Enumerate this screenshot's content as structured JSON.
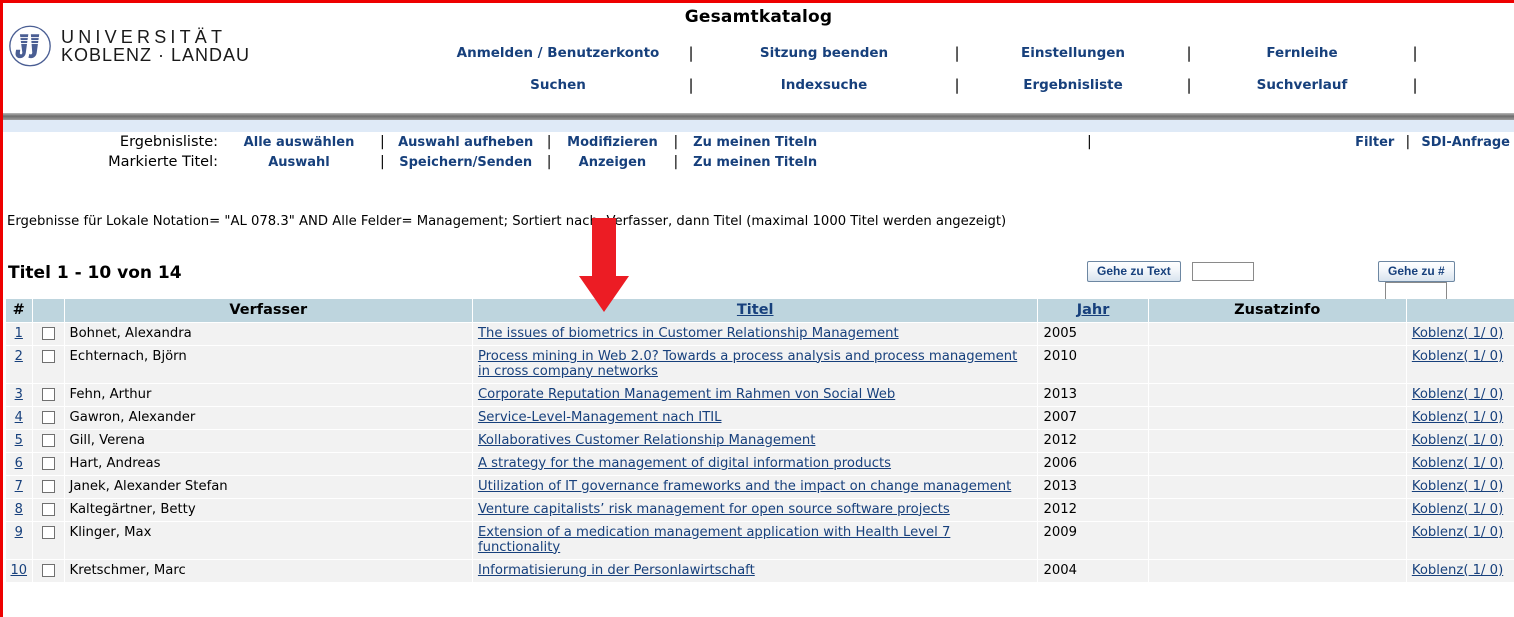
{
  "header": {
    "logo_line1": "UNIVERSITÄT",
    "logo_line2": "KOBLENZ · LANDAU",
    "catalog_title": "Gesamtkatalog",
    "nav_row1": [
      "Anmelden / Benutzerkonto",
      "Sitzung beenden",
      "Einstellungen",
      "Fernleihe"
    ],
    "nav_row2": [
      "Suchen",
      "Indexsuche",
      "Ergebnisliste",
      "Suchverlauf"
    ],
    "separator": "|"
  },
  "toolbar": {
    "row1_label": "Ergebnisliste:",
    "row1_links": [
      "Alle auswählen",
      "Auswahl aufheben",
      "Modifizieren",
      "Zu meinen Titeln"
    ],
    "row2_label": "Markierte Titel:",
    "row2_links": [
      "Auswahl",
      "Speichern/Senden",
      "Anzeigen",
      "Zu meinen Titeln"
    ],
    "right_links": [
      "Filter",
      "SDI-Anfrage"
    ],
    "separator": "|"
  },
  "query": {
    "description": "Ergebnisse für Lokale Notation= \"AL 078.3\" AND Alle Felder= Management; Sortiert nach: Verfasser, dann Titel (maximal 1000 Titel werden angezeigt)"
  },
  "results_info": {
    "count_text": "Titel 1 - 10 von 14",
    "goto_text_button": "Gehe zu Text",
    "goto_text_value": "",
    "goto_num_button": "Gehe zu #",
    "goto_num_value": ""
  },
  "table": {
    "headers": {
      "num": "#",
      "checkbox": "",
      "verfasser": "Verfasser",
      "titel": "Titel",
      "jahr": "Jahr",
      "zusatzinfo": "Zusatzinfo",
      "standort": ""
    },
    "rows": [
      {
        "num": "1",
        "author": "Bohnet, Alexandra",
        "title": "The issues of biometrics in Customer Relationship Management",
        "year": "2005",
        "extra": "",
        "location": "Koblenz( 1/ 0)"
      },
      {
        "num": "2",
        "author": "Echternach, Björn",
        "title": "Process mining in Web 2.0? Towards a process analysis and process management in cross company networks",
        "year": "2010",
        "extra": "",
        "location": "Koblenz( 1/ 0)"
      },
      {
        "num": "3",
        "author": "Fehn, Arthur",
        "title": "Corporate Reputation Management im Rahmen von Social Web",
        "year": "2013",
        "extra": "",
        "location": "Koblenz( 1/ 0)"
      },
      {
        "num": "4",
        "author": "Gawron, Alexander",
        "title": "Service-Level-Management nach ITIL",
        "year": "2007",
        "extra": "",
        "location": "Koblenz( 1/ 0)"
      },
      {
        "num": "5",
        "author": "Gill, Verena",
        "title": "Kollaboratives Customer Relationship Management",
        "year": "2012",
        "extra": "",
        "location": "Koblenz( 1/ 0)"
      },
      {
        "num": "6",
        "author": "Hart, Andreas",
        "title": "A strategy for the management of digital information products",
        "year": "2006",
        "extra": "",
        "location": "Koblenz( 1/ 0)"
      },
      {
        "num": "7",
        "author": "Janek, Alexander Stefan",
        "title": "Utilization of IT governance frameworks and the impact on change management",
        "year": "2013",
        "extra": "",
        "location": "Koblenz( 1/ 0)"
      },
      {
        "num": "8",
        "author": "Kaltegärtner, Betty",
        "title": "Venture capitalists’ risk management for open source software projects",
        "year": "2012",
        "extra": "",
        "location": "Koblenz( 1/ 0)"
      },
      {
        "num": "9",
        "author": "Klinger, Max",
        "title": "Extension of a medication management application with Health Level 7 functionality",
        "year": "2009",
        "extra": "",
        "location": "Koblenz( 1/ 0)"
      },
      {
        "num": "10",
        "author": "Kretschmer, Marc",
        "title": "Informatisierung in der Personlawirtschaft",
        "year": "2004",
        "extra": "",
        "location": "Koblenz( 1/ 0)"
      }
    ]
  },
  "annotation": {
    "arrow_color": "#ec1c24",
    "arrow_points_to": "Titel"
  },
  "colors": {
    "link": "#17407c",
    "table_header_bg": "#bed5de",
    "row_bg": "#f2f2f2",
    "frame_red": "#ee0000",
    "band_blue": "#dfeaf7"
  }
}
